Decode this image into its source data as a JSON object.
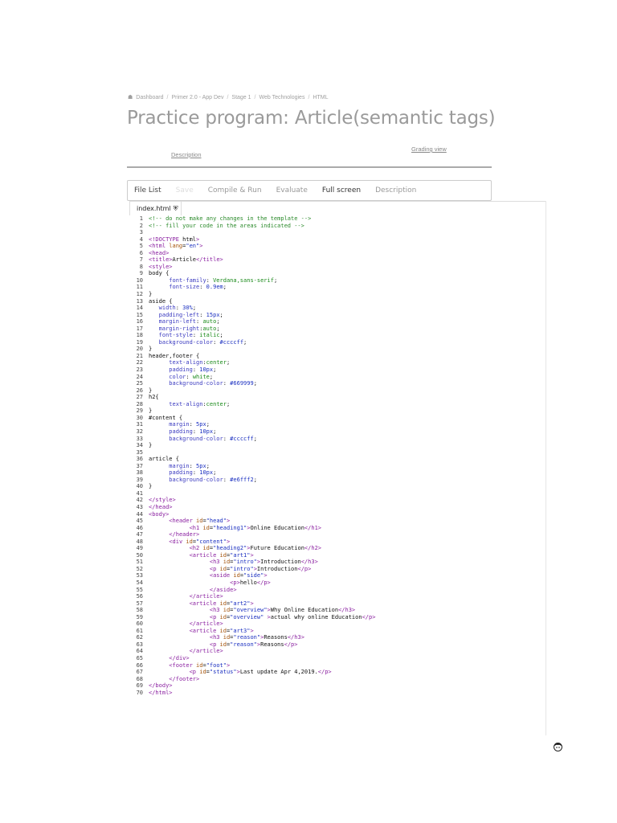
{
  "breadcrumb": [
    "Dashboard",
    "Primer 2.0 - App Dev",
    "Stage 1",
    "Web Technologies",
    "HTML"
  ],
  "title": "Practice program: Article(semantic tags)",
  "links": {
    "description": "Description",
    "grading_view": "Grading view"
  },
  "toolbar": [
    "File List",
    "Save",
    "Compile & Run",
    "Evaluate",
    "Full screen",
    "Description"
  ],
  "file_tab": "index.html",
  "colors": {
    "toolbar_text": "#555",
    "toolbar_disabled": "#ccc",
    "toolbar_muted": "#999"
  },
  "code_lines": [
    "<!-- do not make any changes in the template -->",
    "<!-- fill your code in the areas indicated -->",
    "",
    "<!DOCTYPE html>",
    "<html lang=\"en\">",
    "<head>",
    "<title>Article</title>",
    "<style>",
    "body {",
    "      font-family: Verdana,sans-serif;",
    "      font-size: 0.9em;",
    "}",
    "aside {",
    "   width: 30%;",
    "   padding-left: 15px;",
    "   margin-left: auto;",
    "   margin-right:auto;",
    "   font-style: italic;",
    "   background-color: #ccccff;",
    "}",
    "header,footer {",
    "      text-align:center;",
    "      padding: 10px;",
    "      color: white;",
    "      background-color: #669999;",
    "}",
    "h2{",
    "      text-align:center;",
    "}",
    "#content {",
    "      margin: 5px;",
    "      padding: 10px;",
    "      background-color: #ccccff;",
    "}",
    "",
    "article {",
    "      margin: 5px;",
    "      padding: 10px;",
    "      background-color: #e6fff2;",
    "}",
    "",
    "</style>",
    "</head>",
    "<body>",
    "      <header id=\"head\">",
    "            <h1 id=\"heading1\">Online Education</h1>",
    "      </header>",
    "      <div id=\"content\">",
    "            <h2 id=\"heading2\">Future Education</h2>",
    "            <article id=\"art1\">",
    "                  <h3 id=\"intro\">Introduction</h3>",
    "                  <p id=\"intro\">Introduction</p>",
    "                  <aside id=\"side\">",
    "                        <p>hello</p>",
    "                  </aside>",
    "            </article>",
    "            <article id=\"art2\">",
    "                  <h3 id=\"overview\">Why Online Education</h3>",
    "                  <p id=\"overview\" >actual why online Education</p>",
    "            </article>",
    "            <article id=\"art3\">",
    "                  <h3 id=\"reason\">Reasons</h3>",
    "                  <p id=\"reason\">Reasons</p>",
    "            </article>",
    "      </div>",
    "      <footer id=\"foot\">",
    "            <p id=\"status\">Last update Apr 4,2019.</p>",
    "      </footer>",
    "</body>",
    "</html>"
  ]
}
